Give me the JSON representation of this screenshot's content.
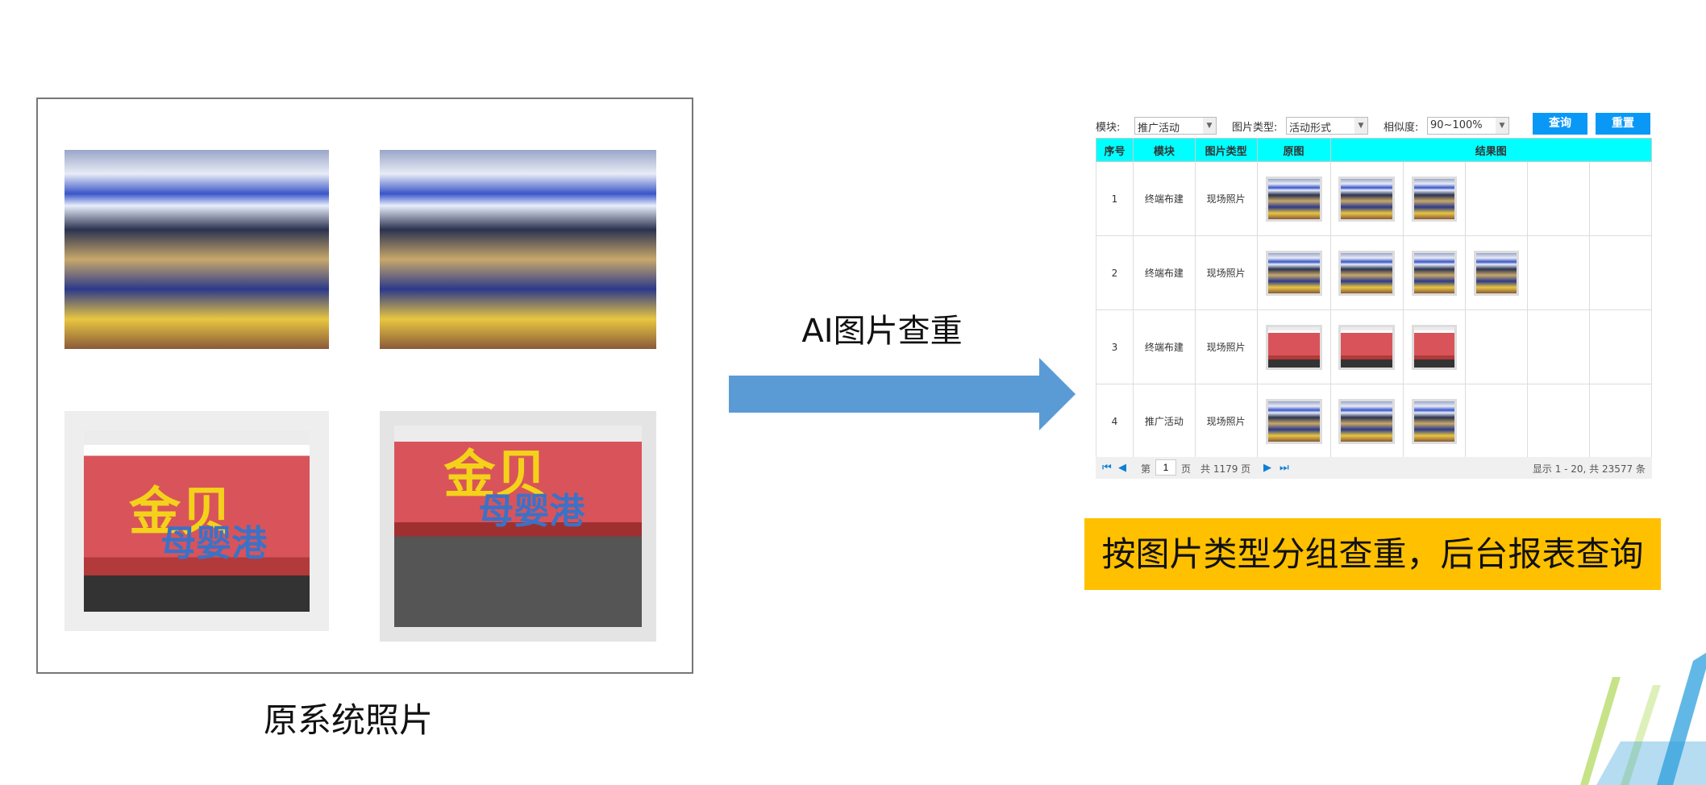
{
  "left": {
    "caption": "原系统照片",
    "photos": [
      {
        "type": "store"
      },
      {
        "type": "store"
      },
      {
        "type": "sign",
        "text1": "金贝",
        "text2": "母婴港"
      },
      {
        "type": "sign",
        "text1": "金贝",
        "text2": "母婴港"
      }
    ]
  },
  "arrow": {
    "label": "AI图片查重",
    "color": "#5b9bd5"
  },
  "filters": {
    "module_label": "模块:",
    "module_value": "推广活动",
    "type_label": "图片类型:",
    "type_value": "活动形式",
    "sim_label": "相似度:",
    "sim_value": "90~100%",
    "query": "查询",
    "reset": "重置"
  },
  "table": {
    "headers": [
      "序号",
      "模块",
      "图片类型",
      "原图",
      "结果图"
    ],
    "rows": [
      {
        "no": "1",
        "module": "终端布建",
        "type": "现场照片",
        "results": 2
      },
      {
        "no": "2",
        "module": "终端布建",
        "type": "现场照片",
        "results": 3
      },
      {
        "no": "3",
        "module": "终端布建",
        "type": "现场照片",
        "results": 2
      },
      {
        "no": "4",
        "module": "推广活动",
        "type": "现场照片",
        "results": 2
      }
    ]
  },
  "pager": {
    "page_prefix": "第",
    "page": "1",
    "page_suffix": "页",
    "total_pages": "共 1179 页",
    "summary": "显示 1 - 20, 共 23577 条"
  },
  "banner": {
    "text": "按图片类型分组查重，后台报表查询",
    "color": "#ffc000"
  },
  "colors": {
    "header": "#00ffff",
    "button": "#0a98f7"
  }
}
